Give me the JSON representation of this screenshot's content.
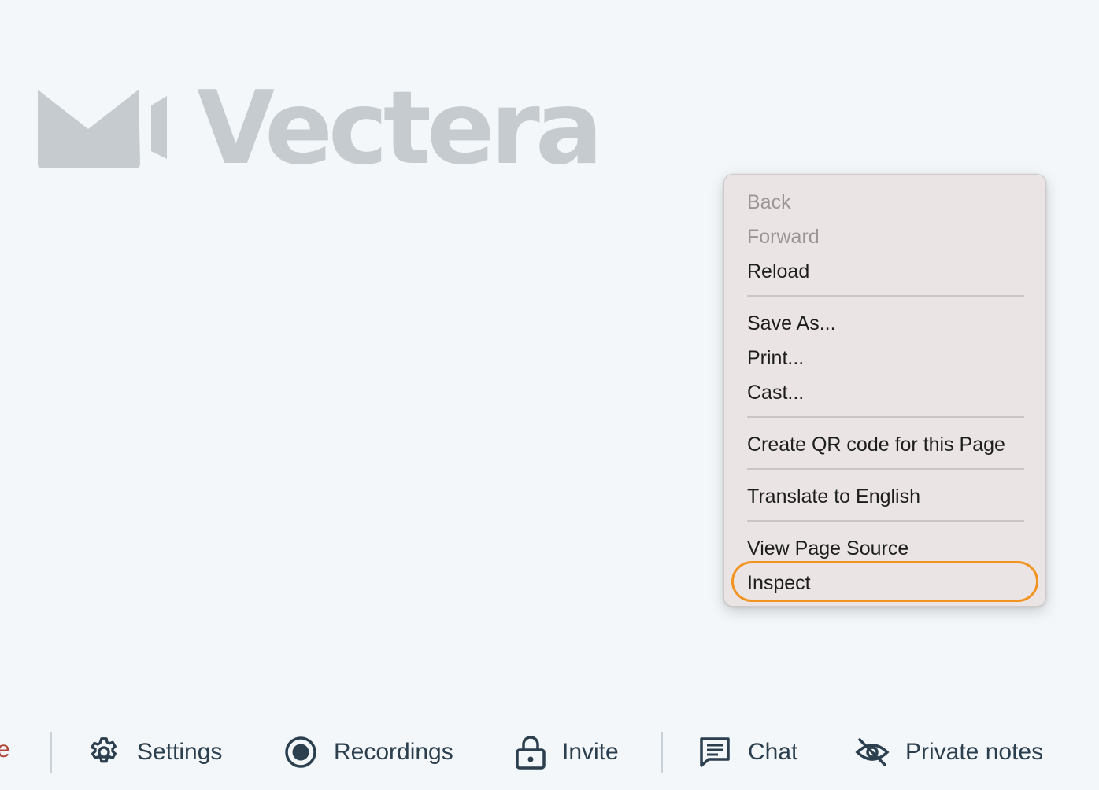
{
  "logo": {
    "text": "Vectera",
    "color": "#c5cbce"
  },
  "context_menu": {
    "items": [
      {
        "label": "Back",
        "enabled": false
      },
      {
        "label": "Forward",
        "enabled": false
      },
      {
        "label": "Reload",
        "enabled": true
      },
      {
        "label": "Save As...",
        "enabled": true
      },
      {
        "label": "Print...",
        "enabled": true
      },
      {
        "label": "Cast...",
        "enabled": true
      },
      {
        "label": "Create QR code for this Page",
        "enabled": true
      },
      {
        "label": "Translate to English",
        "enabled": true
      },
      {
        "label": "View Page Source",
        "enabled": true
      },
      {
        "label": "Inspect",
        "enabled": true,
        "highlighted": true
      }
    ],
    "highlight_color": "#f2941f"
  },
  "toolbar": {
    "cut_label": "e",
    "items": [
      {
        "label": "Settings",
        "icon": "gear-icon"
      },
      {
        "label": "Recordings",
        "icon": "record-icon"
      },
      {
        "label": "Invite",
        "icon": "lock-icon"
      },
      {
        "label": "Chat",
        "icon": "chat-icon"
      },
      {
        "label": "Private notes",
        "icon": "eye-off-icon"
      }
    ],
    "text_color": "#2b3f4e",
    "cut_label_color": "#b5473a"
  }
}
